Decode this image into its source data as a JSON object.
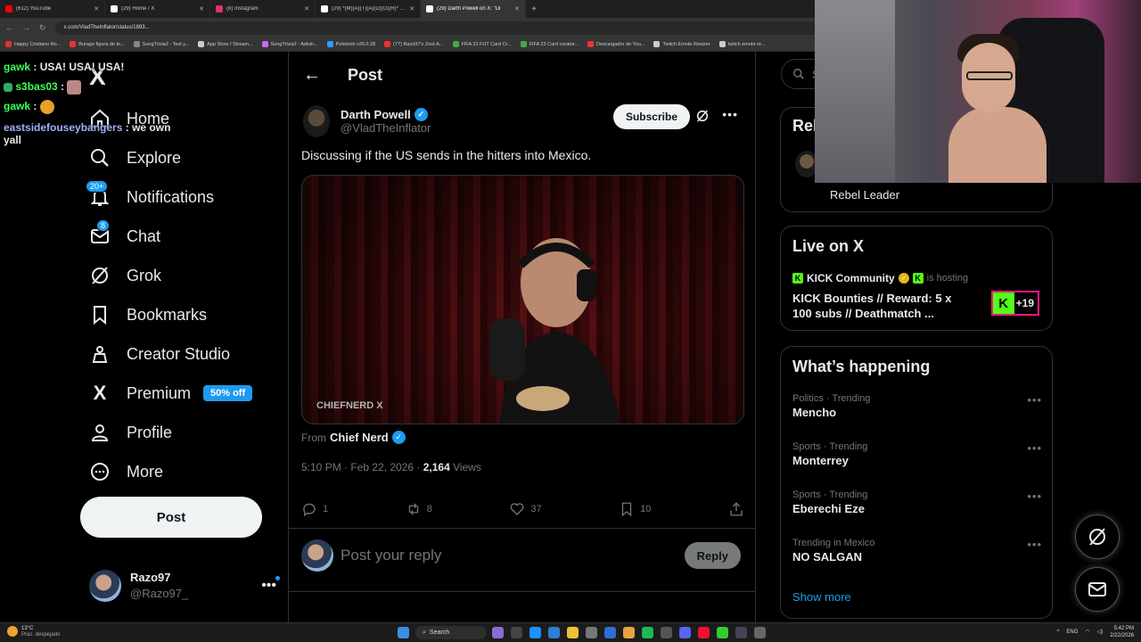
{
  "browser": {
    "tabs": [
      {
        "label": "(612) YouTube",
        "color": "#ff0000"
      },
      {
        "label": "(29) Home / X",
        "color": "#ffffff"
      },
      {
        "label": "(8) Instagram",
        "color": "#e1306c"
      },
      {
        "label": "(29) *(M)(A)(T)(A)(D)(O)(R)* on",
        "color": "#ffffff"
      },
      {
        "label": "(29) Darth Powell on X: \"Di",
        "color": "#ffffff",
        "active": true
      }
    ],
    "new_tab": "+",
    "url": "x.com/VladTheInflator/status/1893...",
    "bookmarks": [
      "Happy Cristiano Ro...",
      "Burago figura de to...",
      "SongTrivia2 - Test y...",
      "App Store / Stream...",
      "SongTrivia2 - Adivin...",
      "Peletoob v26.0.28",
      "(77) Razo97's Zest-A...",
      "FIFA 23 FUT Card Cr...",
      "FIFA 23 Card creator...",
      "Descargador de You...",
      "Twitch Emote Resizer",
      "twitch emote re..."
    ]
  },
  "chat_overlay": [
    {
      "user": "gawk",
      "msg": ": USA! USA! USA!"
    },
    {
      "user": "s3bas03",
      "msg": ":"
    },
    {
      "user": "gawk",
      "msg": ":"
    },
    {
      "user": "eastsidefouseybangers",
      "msg": ": we own yall"
    }
  ],
  "sidebar": {
    "logo": "X",
    "items": [
      {
        "label": "Home",
        "icon": "home-icon"
      },
      {
        "label": "Explore",
        "icon": "search-icon"
      },
      {
        "label": "Notifications",
        "icon": "bell-icon",
        "badge": "20+"
      },
      {
        "label": "Chat",
        "icon": "mail-icon",
        "badge": "8"
      },
      {
        "label": "Grok",
        "icon": "grok-icon"
      },
      {
        "label": "Bookmarks",
        "icon": "bookmark-icon"
      },
      {
        "label": "Creator Studio",
        "icon": "creator-studio-icon"
      },
      {
        "label": "Premium",
        "icon": "x-premium-icon",
        "pill": "50% off"
      },
      {
        "label": "Profile",
        "icon": "person-icon"
      },
      {
        "label": "More",
        "icon": "more-circle-icon"
      }
    ],
    "post_label": "Post",
    "account": {
      "name": "Razo97",
      "handle": "@Razo97_"
    }
  },
  "main": {
    "header_title": "Post",
    "author": {
      "name": "Darth Powell",
      "handle": "@VladTheInflator"
    },
    "subscribe_label": "Subscribe",
    "post_text": "Discussing if the US sends in the hitters into Mexico.",
    "media_watermark": "CHIEFNERD X",
    "from_prefix": "From",
    "from_source": "Chief Nerd",
    "timestamp": "5:10 PM · Feb 22, 2026 ·",
    "views_count": "2,164",
    "views_label": "Views",
    "actions": {
      "replies": "1",
      "reposts": "8",
      "likes": "37",
      "bookmarks": "10"
    },
    "reply_placeholder": "Post your reply",
    "reply_button": "Reply"
  },
  "right": {
    "search_placeholder": "Se",
    "relevant": {
      "title": "Rel",
      "name": "Rebel Leader"
    },
    "live": {
      "title": "Live on X",
      "host_name": "KICK Community",
      "host_suffix": "is hosting",
      "stream_title": "KICK Bounties // Reward: 5 x 100 subs // Deathmatch ...",
      "listener_count": "+19"
    },
    "happening": {
      "title": "What’s happening",
      "trends": [
        {
          "category": "Politics · Trending",
          "topic": "Mencho"
        },
        {
          "category": "Sports · Trending",
          "topic": "Monterrey"
        },
        {
          "category": "Sports · Trending",
          "topic": "Eberechi Eze"
        },
        {
          "category": "Trending in Mexico",
          "topic": "NO SALGAN"
        }
      ],
      "show_more": "Show more"
    }
  },
  "taskbar": {
    "temp": "13°C",
    "weather_desc": "Prac. despejado",
    "search_label": "Search",
    "lang": "ENG",
    "time": "5:42 PM",
    "date": "2/22/2026"
  },
  "colors": {
    "accent": "#1d9bf0",
    "kick": "#53fc18",
    "bg": "#000000"
  }
}
